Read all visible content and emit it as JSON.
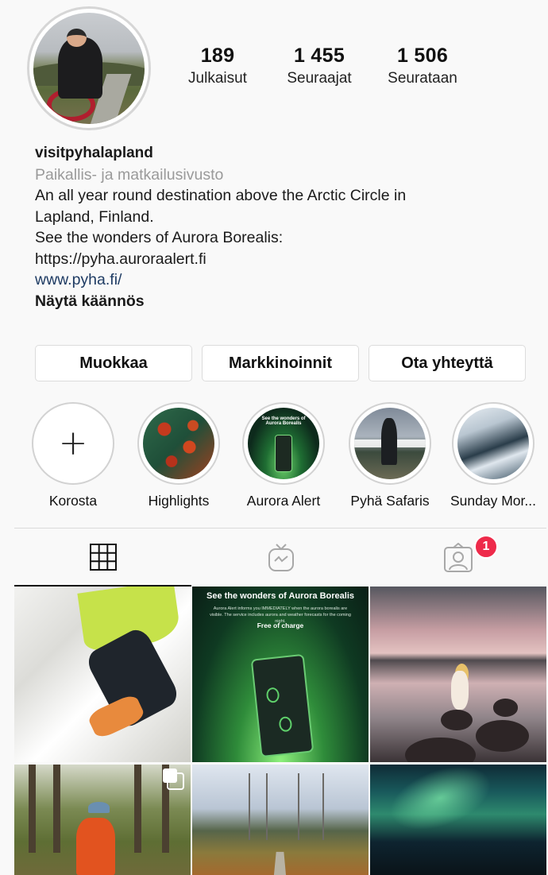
{
  "profile": {
    "username": "visitpyhalapland",
    "category": "Paikallis- ja matkailusivusto",
    "bio_lines": [
      "An all year round destination above the Arctic Circle in",
      "Lapland, Finland.",
      "See the wonders of Aurora Borealis:",
      "https://pyha.auroraalert.fi"
    ],
    "website": "www.pyha.fi/",
    "translate_label": "Näytä käännös"
  },
  "stats": [
    {
      "value": "189",
      "label": "Julkaisut"
    },
    {
      "value": "1 455",
      "label": "Seuraajat"
    },
    {
      "value": "1 506",
      "label": "Seurataan"
    }
  ],
  "actions": {
    "edit": "Muokkaa",
    "promotions": "Markkinoinnit",
    "contact": "Ota yhteyttä"
  },
  "highlights": [
    {
      "label": "Korosta",
      "icon": "plus-icon"
    },
    {
      "label": "Highlights"
    },
    {
      "label": "Aurora Alert",
      "thumb_text": "See the wonders of Aurora Borealis"
    },
    {
      "label": "Pyhä Safaris"
    },
    {
      "label": "Sunday Mor..."
    }
  ],
  "tabs": {
    "grid_icon": "grid-icon",
    "igtv_icon": "igtv-icon",
    "tagged_icon": "tagged-person-icon",
    "tagged_badge": "1",
    "badge_color": "#ee2a4a"
  },
  "posts": {
    "aurora_post": {
      "title": "See the wonders of Aurora Borealis",
      "subtitle": "Aurora Alert informs you IMMEDIATELY when the aurora borealis are visible. The service includes aurora and weather forecasts for the coming night.",
      "free": "Free of charge"
    }
  },
  "colors": {
    "link": "#1e3b63",
    "category": "#9a9a9a",
    "aurora_green": "#6fd36b"
  }
}
